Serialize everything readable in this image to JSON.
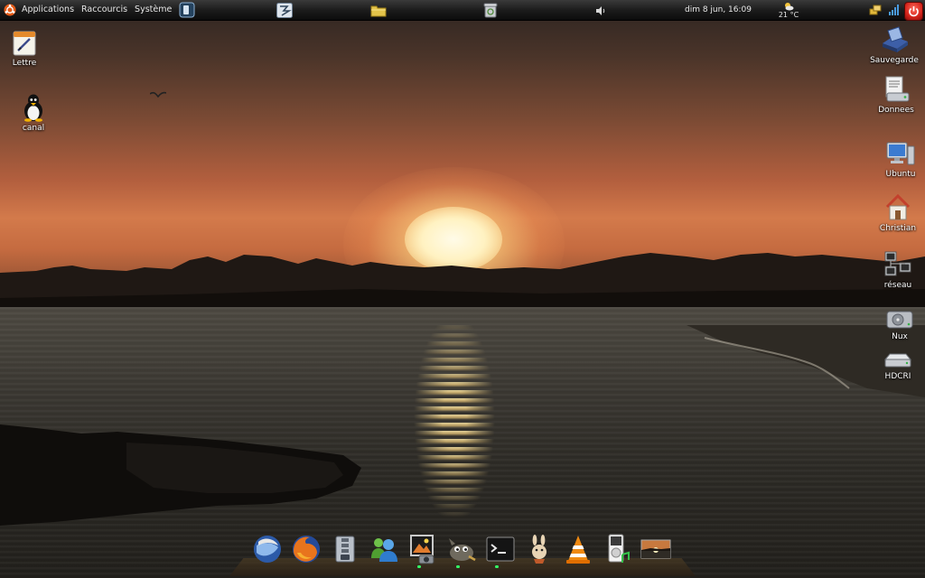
{
  "top_panel": {
    "menu": [
      {
        "label": "Applications"
      },
      {
        "label": "Raccourcis"
      },
      {
        "label": "Système"
      }
    ],
    "clock": "dim  8 jun, 16:09",
    "weather": {
      "temp": "21 °C",
      "icon": "partly-cloudy-icon"
    },
    "taskbar_icons": [
      "switcher-icon",
      "folder-icon",
      "trash-icon",
      "volume-icon"
    ],
    "tray_icons": [
      "network-icon",
      "signal-icon",
      "power-icon"
    ]
  },
  "desktop": {
    "left_icons": [
      {
        "label": "Lettre",
        "icon": "document-icon"
      },
      {
        "label": "canal",
        "icon": "tux-icon"
      }
    ],
    "right_icons": [
      {
        "label": "Sauvegarde",
        "icon": "backup-icon"
      },
      {
        "label": "Donnees",
        "icon": "drive-doc-icon"
      },
      {
        "label": "Ubuntu",
        "icon": "computer-icon"
      },
      {
        "label": "Christian",
        "icon": "home-icon"
      },
      {
        "label": "réseau",
        "icon": "network-icon"
      },
      {
        "label": "Nux",
        "icon": "harddisk-icon"
      },
      {
        "label": "HDCRI",
        "icon": "harddisk-icon"
      }
    ]
  },
  "dock": {
    "items": [
      "thunderbird-icon",
      "firefox-icon",
      "archive-icon",
      "messenger-icon",
      "photo-viewer-icon",
      "gimp-icon",
      "terminal-icon",
      "torrent-icon",
      "vlc-icon",
      "music-player-icon",
      "wallpaper-icon"
    ]
  },
  "colors": {
    "panel_bg": "#1c1c1c",
    "sky_orange": "#d37a4b",
    "power_red": "#d4241b",
    "dock_indicator": "#33ff66"
  }
}
